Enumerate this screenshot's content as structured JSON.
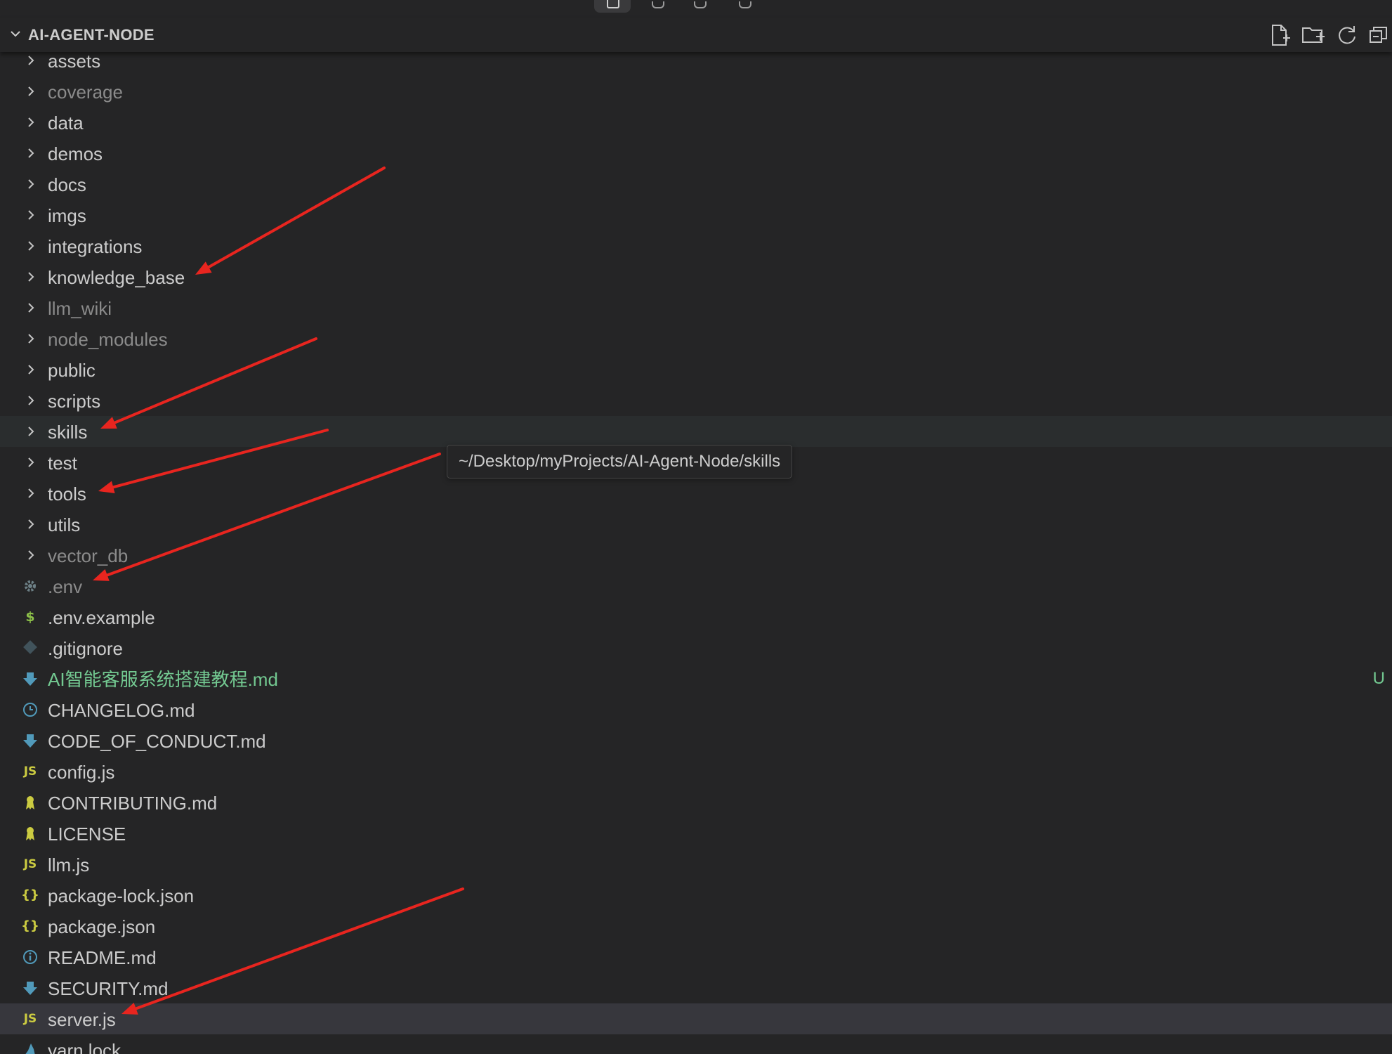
{
  "explorer": {
    "title": "AI-AGENT-NODE",
    "actions": [
      {
        "name": "new-file-button",
        "icon": "new-file-icon"
      },
      {
        "name": "new-folder-button",
        "icon": "new-folder-icon"
      },
      {
        "name": "refresh-button",
        "icon": "refresh-icon"
      },
      {
        "name": "collapse-folders-button",
        "icon": "collapse-all-icon"
      }
    ]
  },
  "tree": [
    {
      "label": "assets",
      "kind": "folder",
      "dim": false
    },
    {
      "label": "coverage",
      "kind": "folder",
      "dim": true
    },
    {
      "label": "data",
      "kind": "folder",
      "dim": false
    },
    {
      "label": "demos",
      "kind": "folder",
      "dim": false
    },
    {
      "label": "docs",
      "kind": "folder",
      "dim": false
    },
    {
      "label": "imgs",
      "kind": "folder",
      "dim": false
    },
    {
      "label": "integrations",
      "kind": "folder",
      "dim": false
    },
    {
      "label": "knowledge_base",
      "kind": "folder",
      "dim": false
    },
    {
      "label": "llm_wiki",
      "kind": "folder",
      "dim": true
    },
    {
      "label": "node_modules",
      "kind": "folder",
      "dim": true
    },
    {
      "label": "public",
      "kind": "folder",
      "dim": false
    },
    {
      "label": "scripts",
      "kind": "folder",
      "dim": false
    },
    {
      "label": "skills",
      "kind": "folder",
      "dim": false,
      "hover": true
    },
    {
      "label": "test",
      "kind": "folder",
      "dim": false
    },
    {
      "label": "tools",
      "kind": "folder",
      "dim": false
    },
    {
      "label": "utils",
      "kind": "folder",
      "dim": false
    },
    {
      "label": "vector_db",
      "kind": "folder",
      "dim": true
    },
    {
      "label": ".env",
      "kind": "file",
      "icon": "gear-icon",
      "dim": true
    },
    {
      "label": ".env.example",
      "kind": "file",
      "icon": "dollar-icon",
      "dim": false
    },
    {
      "label": ".gitignore",
      "kind": "file",
      "icon": "git-icon",
      "dim": false
    },
    {
      "label": "AI智能客服系统搭建教程.md",
      "kind": "file",
      "icon": "markdown-download-icon",
      "status": "untracked",
      "badge": "U"
    },
    {
      "label": "CHANGELOG.md",
      "kind": "file",
      "icon": "clock-icon",
      "dim": false
    },
    {
      "label": "CODE_OF_CONDUCT.md",
      "kind": "file",
      "icon": "markdown-download-icon",
      "dim": false
    },
    {
      "label": "config.js",
      "kind": "file",
      "icon": "js-icon",
      "dim": false
    },
    {
      "label": "CONTRIBUTING.md",
      "kind": "file",
      "icon": "ribbon-icon",
      "dim": false
    },
    {
      "label": "LICENSE",
      "kind": "file",
      "icon": "ribbon-icon",
      "dim": false
    },
    {
      "label": "llm.js",
      "kind": "file",
      "icon": "js-icon",
      "dim": false
    },
    {
      "label": "package-lock.json",
      "kind": "file",
      "icon": "json-braces-icon",
      "dim": false
    },
    {
      "label": "package.json",
      "kind": "file",
      "icon": "json-braces-icon",
      "dim": false
    },
    {
      "label": "README.md",
      "kind": "file",
      "icon": "info-icon",
      "dim": false
    },
    {
      "label": "SECURITY.md",
      "kind": "file",
      "icon": "markdown-download-icon",
      "dim": false
    },
    {
      "label": "server.js",
      "kind": "file",
      "icon": "js-icon",
      "dim": false,
      "selected": true
    },
    {
      "label": "yarn.lock",
      "kind": "file",
      "icon": "yarn-icon",
      "dim": false
    }
  ],
  "tooltip": {
    "text": "~/Desktop/myProjects/AI-Agent-Node/skills"
  },
  "annotations": {
    "color": "#e8251f",
    "arrows_point_to": [
      "knowledge_base",
      "skills",
      "tools",
      ".env",
      "server.js"
    ]
  },
  "colors": {
    "background": "#252526",
    "text": "#cccccc",
    "dim_text": "#8b8b8b",
    "untracked": "#73c991",
    "selected_row": "#37373d",
    "hover_row": "#2a2d2e",
    "js_icon": "#cbcb41",
    "md_icon": "#519aba"
  }
}
